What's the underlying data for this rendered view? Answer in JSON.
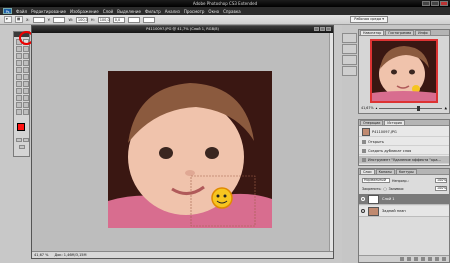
{
  "app": {
    "window_title": "Adobe Photoshop CS3 Extended",
    "logo": "Ps"
  },
  "menu": [
    "Файл",
    "Редактирование",
    "Изображение",
    "Слой",
    "Выделение",
    "Фильтр",
    "Анализ",
    "Просмотр",
    "Окно",
    "Справка"
  ],
  "options_bar": {
    "w_value": "100,0",
    "h_value": "100,0",
    "angle_value": "0,0",
    "workspace_label": "Рабочая среда ▾"
  },
  "toolbox": {
    "foreground_color": "#ff1212",
    "background_color": "#ffffff"
  },
  "document": {
    "title": "P4110097.JPG @ 41,7% (Слой 1, RGB/8)",
    "zoom": "41,67 %",
    "doc_size": "Док: 1,46M/3,15M"
  },
  "navigator": {
    "tabs": [
      "Навигатор",
      "Гистограмма",
      "Инфо"
    ],
    "zoom_value": "41,67%"
  },
  "history": {
    "tabs": [
      "Операции",
      "История"
    ],
    "items": [
      {
        "label": "P4110097.JPG"
      },
      {
        "label": "Открыть"
      },
      {
        "label": "Создать дубликат слоя"
      },
      {
        "label": "Инструмент \"Удаление эффекта \"кра..."
      }
    ]
  },
  "layers": {
    "tabs": [
      "Слои",
      "Каналы",
      "Контуры"
    ],
    "blend_mode": "Нормальный",
    "opacity_label": "Непрозр.:",
    "opacity_value": "100%",
    "lock_label": "Закрепить:",
    "fill_label": "Заливка:",
    "fill_value": "100%",
    "items": [
      {
        "name": "Слой 1",
        "selected": true
      },
      {
        "name": "Задний план",
        "selected": false
      }
    ]
  }
}
